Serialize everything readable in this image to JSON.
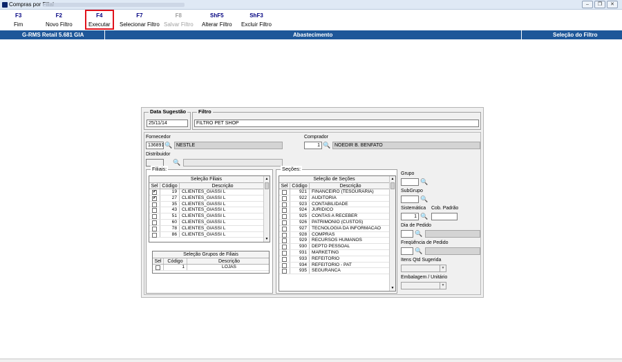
{
  "window": {
    "title": "Compras por Filial"
  },
  "toolbar": [
    {
      "key": "F3",
      "label": "Fim",
      "enabled": true
    },
    {
      "key": "F2",
      "label": "Novo Filtro",
      "enabled": true
    },
    {
      "key": "F4",
      "label": "Executar",
      "enabled": true,
      "highlighted": true
    },
    {
      "key": "F7",
      "label": "Selecionar Filtro",
      "enabled": true
    },
    {
      "key": "F8",
      "label": "Salvar Filtro",
      "enabled": false
    },
    {
      "key": "ShF5",
      "label": "Alterar Filtro",
      "enabled": true
    },
    {
      "key": "ShF3",
      "label": "Excluir Filtro",
      "enabled": true
    }
  ],
  "infobar": {
    "version": "G-RMS Retail 5.681 GIA",
    "module": "Abastecimento",
    "section": "Seleção do Filtro"
  },
  "form": {
    "data_sugestao": {
      "label": "Data Sugestão",
      "value": "25/11/14"
    },
    "filtro": {
      "label": "Filtro",
      "value": "FILTRO PET SHOP"
    },
    "fornecedor": {
      "label": "Fornecedor",
      "code": "136891",
      "name": "NESTLE"
    },
    "comprador": {
      "label": "Comprador",
      "code": "1",
      "name": "NOEDIR B. BENFATO"
    },
    "distribuidor": {
      "label": "Distribuidor",
      "code": "",
      "name": ""
    },
    "filiais_label": "Filiais:",
    "secoes_label": "Seções:",
    "grupo": {
      "label": "Grupo",
      "value": ""
    },
    "subgrupo": {
      "label": "SubGrupo",
      "value": ""
    },
    "sistematica": {
      "label": "Sistemática",
      "value": "1"
    },
    "cob_padrao": {
      "label": "Cob. Padrão",
      "value": ""
    },
    "dia_pedido": {
      "label": "Dia de Pedido",
      "value": ""
    },
    "frequencia_pedido": {
      "label": "Freqüência de Pedido",
      "value": ""
    },
    "itens_qtd_sugerida": {
      "label": "Itens Qtd Sugerida",
      "value": ""
    },
    "embalagem_unitario": {
      "label": "Embalagem / Unitário",
      "value": ""
    }
  },
  "filiais_table": {
    "caption": "Seleção Filiais",
    "columns": [
      "Sel",
      "Código",
      "Descrição"
    ],
    "rows": [
      {
        "sel": true,
        "code": "19",
        "desc": "CLIENTES_GIASSI L"
      },
      {
        "sel": true,
        "code": "27",
        "desc": "CLIENTES_GIASSI L"
      },
      {
        "sel": false,
        "code": "35",
        "desc": "CLIENTES_GIASSI L"
      },
      {
        "sel": false,
        "code": "43",
        "desc": "CLIENTES_GIASSI L"
      },
      {
        "sel": false,
        "code": "51",
        "desc": "CLIENTES_GIASSI L"
      },
      {
        "sel": false,
        "code": "60",
        "desc": "CLIENTES_GIASSI L"
      },
      {
        "sel": false,
        "code": "78",
        "desc": "CLIENTES_GIASSI L"
      },
      {
        "sel": false,
        "code": "86",
        "desc": "CLIENTES_GIASSI L"
      }
    ]
  },
  "grupos_filiais_table": {
    "caption": "Seleção Grupos de Filiais",
    "columns": [
      "Sel",
      "Código",
      "Descrição"
    ],
    "rows": [
      {
        "sel": false,
        "code": "1",
        "desc": "LOJAS"
      }
    ]
  },
  "secoes_table": {
    "caption": "Seleção de Seções",
    "columns": [
      "Sel",
      "Código",
      "Descrição"
    ],
    "rows": [
      {
        "sel": false,
        "code": "921",
        "desc": "FINANCEIRO (TESOURARIA)"
      },
      {
        "sel": false,
        "code": "922",
        "desc": "AUDITORIA"
      },
      {
        "sel": false,
        "code": "923",
        "desc": "CONTABILIDADE"
      },
      {
        "sel": false,
        "code": "924",
        "desc": "JURIDICO"
      },
      {
        "sel": false,
        "code": "925",
        "desc": "CONTAS A RECEBER"
      },
      {
        "sel": false,
        "code": "926",
        "desc": "PATRIMONIO (CUSTOS)"
      },
      {
        "sel": false,
        "code": "927",
        "desc": "TECNOLOGIA DA INFORMACAO"
      },
      {
        "sel": false,
        "code": "928",
        "desc": "COMPRAS"
      },
      {
        "sel": false,
        "code": "929",
        "desc": "RECURSOS HUMANOS"
      },
      {
        "sel": false,
        "code": "930",
        "desc": "DEPTO PESSOAL"
      },
      {
        "sel": false,
        "code": "931",
        "desc": "MARKETING"
      },
      {
        "sel": false,
        "code": "933",
        "desc": "REFEITORIO"
      },
      {
        "sel": false,
        "code": "934",
        "desc": "REFEITORIO - PAT"
      },
      {
        "sel": false,
        "code": "935",
        "desc": "SEGURANCA"
      }
    ]
  }
}
